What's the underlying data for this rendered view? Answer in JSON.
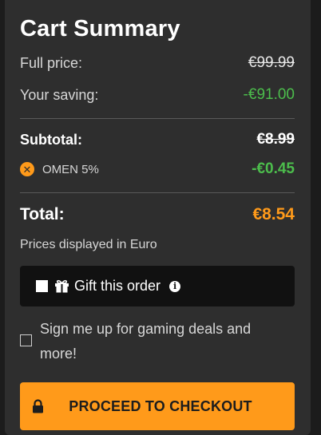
{
  "cart": {
    "title": "Cart Summary",
    "full_price_label": "Full price:",
    "full_price_value": "€99.99",
    "saving_label": "Your saving:",
    "saving_value": "-€91.00",
    "subtotal_label": "Subtotal:",
    "subtotal_value": "€8.99",
    "coupon_label": "OMEN 5%",
    "coupon_value": "-€0.45",
    "total_label": "Total:",
    "total_value": "€8.54",
    "currency_note": "Prices displayed in Euro",
    "gift_label": "Gift this order",
    "signup_label": "Sign me up for gaming deals and more!",
    "checkout_label": "PROCEED TO CHECKOUT"
  },
  "colors": {
    "accent": "#ff9a1a",
    "saving": "#4cbd4c",
    "panel": "#2e2e2e"
  },
  "icons": {
    "coupon": "remove-coupon-icon",
    "gift": "gift-icon",
    "info": "info-icon",
    "lock": "lock-icon"
  }
}
